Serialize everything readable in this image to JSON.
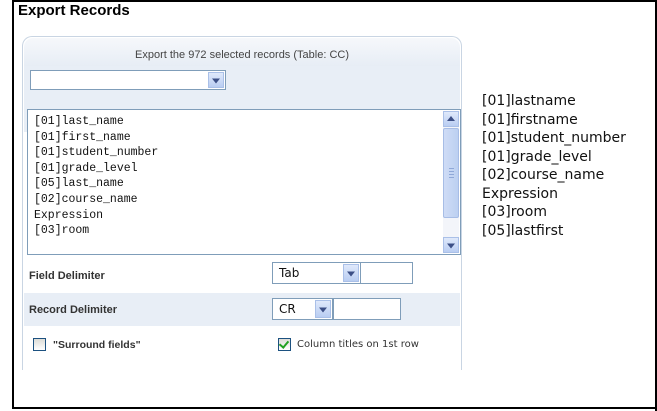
{
  "title": "Export Records",
  "panel": {
    "header": "Export the 972 selected records (Table: CC)",
    "dropdown_value": ""
  },
  "list": {
    "items": [
      "[01]last_name",
      "[01]first_name",
      "[01]student_number",
      "[01]grade_level",
      "[05]last_name",
      "[02]course_name",
      "Expression",
      "[03]room"
    ]
  },
  "field_delimiter": {
    "label": "Field Delimiter",
    "value": "Tab",
    "custom": ""
  },
  "record_delimiter": {
    "label": "Record Delimiter",
    "value": "CR",
    "custom": ""
  },
  "options": {
    "surround_fields": {
      "label": "\"Surround fields\"",
      "checked": false
    },
    "column_titles": {
      "label": "Column titles on 1st row",
      "checked": true
    }
  },
  "side_list": [
    "[01]lastname",
    "[01]firstname",
    "[01]student_number",
    "[01]grade_level",
    "[02]course_name",
    "Expression",
    "[03]room",
    "[05]lastfirst"
  ],
  "colors": {
    "panel_border": "#c9d5e3",
    "band": "#e8eef6",
    "check": "#21a121"
  }
}
